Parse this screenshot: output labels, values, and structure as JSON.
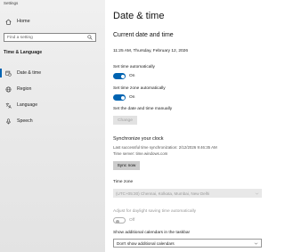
{
  "sidebar": {
    "app_title": "Settings",
    "home_label": "Home",
    "search_placeholder": "Find a setting",
    "section_title": "Time & Language",
    "items": [
      {
        "label": "Date & time",
        "icon": "calendar-clock-icon",
        "active": true
      },
      {
        "label": "Region",
        "icon": "globe-icon",
        "active": false
      },
      {
        "label": "Language",
        "icon": "language-icon",
        "active": false
      },
      {
        "label": "Speech",
        "icon": "microphone-icon",
        "active": false
      }
    ]
  },
  "main": {
    "title": "Date & time",
    "current_heading": "Current date and time",
    "current_datetime": "11:25 AM, Thursday, February 12, 2026",
    "set_time_auto": {
      "label": "Set time automatically",
      "state": "On"
    },
    "set_timezone_auto": {
      "label": "Set time zone automatically",
      "state": "On"
    },
    "manual": {
      "label": "Set the date and time manually",
      "button": "Change"
    },
    "sync": {
      "heading": "Synchronize your clock",
      "last_sync": "Last successful time synchronization: 2/12/2026 9:46:35 AM",
      "time_server": "Time server: time.windows.com",
      "button": "Sync now"
    },
    "timezone": {
      "label": "Time zone",
      "value": "(UTC+05:30) Chennai, Kolkata, Mumbai, New Delhi"
    },
    "dst": {
      "label": "Adjust for daylight saving time automatically",
      "state": "Off"
    },
    "calendars": {
      "label": "Show additional calendars in the taskbar",
      "value": "Don't show additional calendars"
    }
  },
  "colors": {
    "accent": "#0063b1",
    "sidebar_bg": "#eaeaea",
    "button_bg": "#cccccc"
  }
}
